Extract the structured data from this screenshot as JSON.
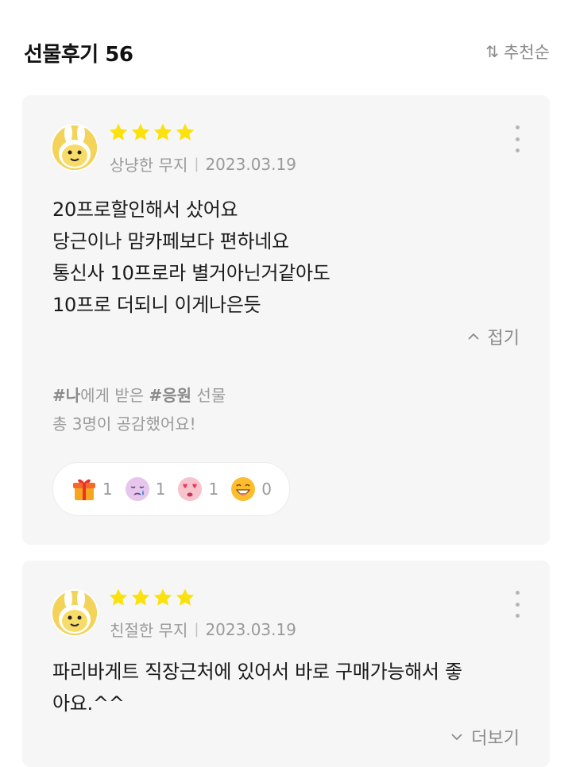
{
  "header": {
    "title": "선물후기 56",
    "sort_label": "추천순"
  },
  "reviews": [
    {
      "rating": 4,
      "author": "상냥한 무지",
      "date": "2023.03.19",
      "lines": [
        "20프로할인해서 샀어요",
        "당근이나 맘카페보다 편하네요",
        "통신사 10프로라 별거아닌거같아도",
        "10프로 더되니 이게나은듯"
      ],
      "toggle_label": "접기",
      "gift_from": "#나",
      "gift_mid": "에게 받은 ",
      "gift_tag": "#응원",
      "gift_end": " 선물",
      "empathy": "총 3명이 공감했어요!",
      "reactions": [
        {
          "icon": "gift-emoji-icon",
          "count": "1"
        },
        {
          "icon": "crying-emoji-icon",
          "count": "1"
        },
        {
          "icon": "heart-eyes-emoji-icon",
          "count": "1"
        },
        {
          "icon": "laughing-emoji-icon",
          "count": "0"
        }
      ]
    },
    {
      "rating": 4,
      "author": "친절한 무지",
      "date": "2023.03.19",
      "lines": [
        "파리바게트 직장근처에 있어서 바로 구매가능해서 좋",
        "아요.^^"
      ],
      "toggle_label": "더보기"
    }
  ],
  "colors": {
    "star": "#fbe10d",
    "card_bg": "#f6f6f6",
    "muted_text": "#9a9a9a"
  }
}
